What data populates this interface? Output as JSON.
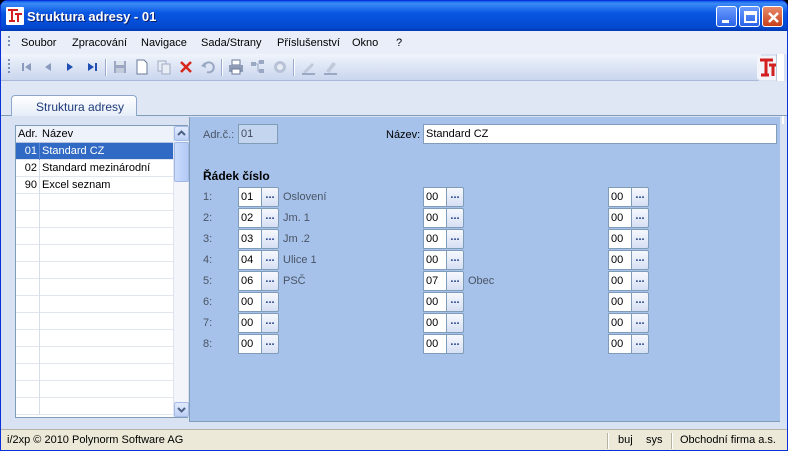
{
  "window": {
    "title": "Struktura adresy - 01"
  },
  "menu": [
    "Soubor",
    "Zpracování",
    "Navigace",
    "Sada/Strany",
    "Příslušenství",
    "Okno",
    "?"
  ],
  "toolbar": {
    "icons": [
      "first-record-icon",
      "previous-record-icon",
      "next-record-icon",
      "last-record-icon",
      "save-icon",
      "new-icon",
      "copy-icon",
      "delete-icon",
      "undo-icon",
      "print-icon",
      "tree-icon",
      "record-icon",
      "edit-icon",
      "erase-icon"
    ]
  },
  "tab": {
    "label": "Struktura adresy"
  },
  "grid": {
    "headers": {
      "adr": "Adr.",
      "name": "Název"
    },
    "rows": [
      {
        "adr": "01",
        "name": "Standard CZ",
        "selected": true
      },
      {
        "adr": "02",
        "name": "Standard mezinárodní",
        "selected": false
      },
      {
        "adr": "90",
        "name": "Excel seznam",
        "selected": false
      }
    ]
  },
  "form": {
    "adr_label": "Adr.č.:",
    "adr_value": "01",
    "name_label": "Název:",
    "name_value": "Standard CZ",
    "section_title": "Řádek číslo",
    "spin_button": "...",
    "lines": [
      {
        "num": "1:",
        "a": "01",
        "a_label": "Oslovení",
        "b": "00",
        "b_label": "",
        "c": "00"
      },
      {
        "num": "2:",
        "a": "02",
        "a_label": "Jm. 1",
        "b": "00",
        "b_label": "",
        "c": "00"
      },
      {
        "num": "3:",
        "a": "03",
        "a_label": "Jm .2",
        "b": "00",
        "b_label": "",
        "c": "00"
      },
      {
        "num": "4:",
        "a": "04",
        "a_label": "Ulice 1",
        "b": "00",
        "b_label": "",
        "c": "00"
      },
      {
        "num": "5:",
        "a": "06",
        "a_label": "PSČ",
        "b": "07",
        "b_label": "Obec",
        "c": "00"
      },
      {
        "num": "6:",
        "a": "00",
        "a_label": "",
        "b": "00",
        "b_label": "",
        "c": "00"
      },
      {
        "num": "7:",
        "a": "00",
        "a_label": "",
        "b": "00",
        "b_label": "",
        "c": "00"
      },
      {
        "num": "8:",
        "a": "00",
        "a_label": "",
        "b": "00",
        "b_label": "",
        "c": "00"
      }
    ]
  },
  "status": {
    "copyright": "i/2xp © 2010 Polynorm Software AG",
    "user": "buj",
    "db": "sys",
    "company": "Obchodní firma a.s."
  },
  "colors": {
    "selection": "#316ac5",
    "panel": "#a6c2ea",
    "titlebar": "#0857e3"
  }
}
